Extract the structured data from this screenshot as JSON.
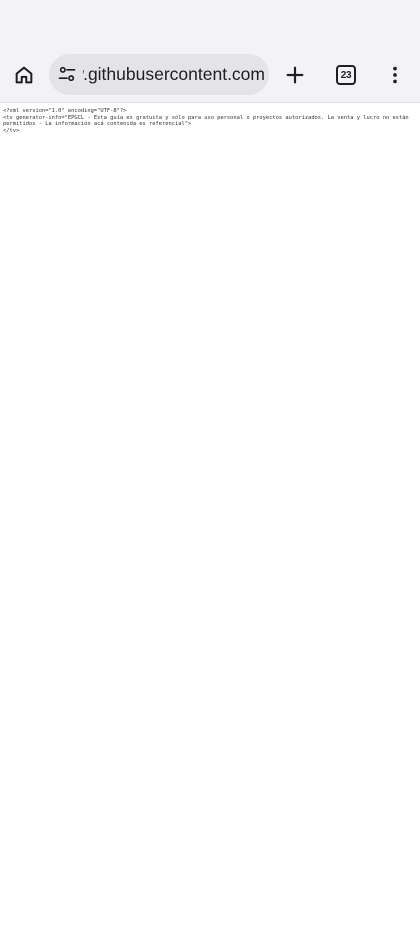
{
  "browser": {
    "url_display": "raw.githubusercontent.com",
    "tab_count": "23",
    "icons": {
      "home": "home-icon",
      "site_settings": "tune-icon",
      "new_tab": "plus-icon",
      "tabs": "tab-switcher-icon",
      "menu": "more-vert-icon"
    }
  },
  "document": {
    "lines": [
      "<?xml version=\"1.0\" encoding=\"UTF-8\"?>",
      "<tv generator-info=\"EPGCL - Esta guía es gratuita y sólo para uso personal o proyectos autorizados. La venta y lucro no están permitidos - La información acá contenida es referencial\">",
      "</tv>"
    ]
  },
  "colors": {
    "toolbar_bg": "#f3f3f7",
    "omnibox_bg": "#e3e3e8",
    "icon": "#1f1f1f",
    "text": "#333333"
  }
}
